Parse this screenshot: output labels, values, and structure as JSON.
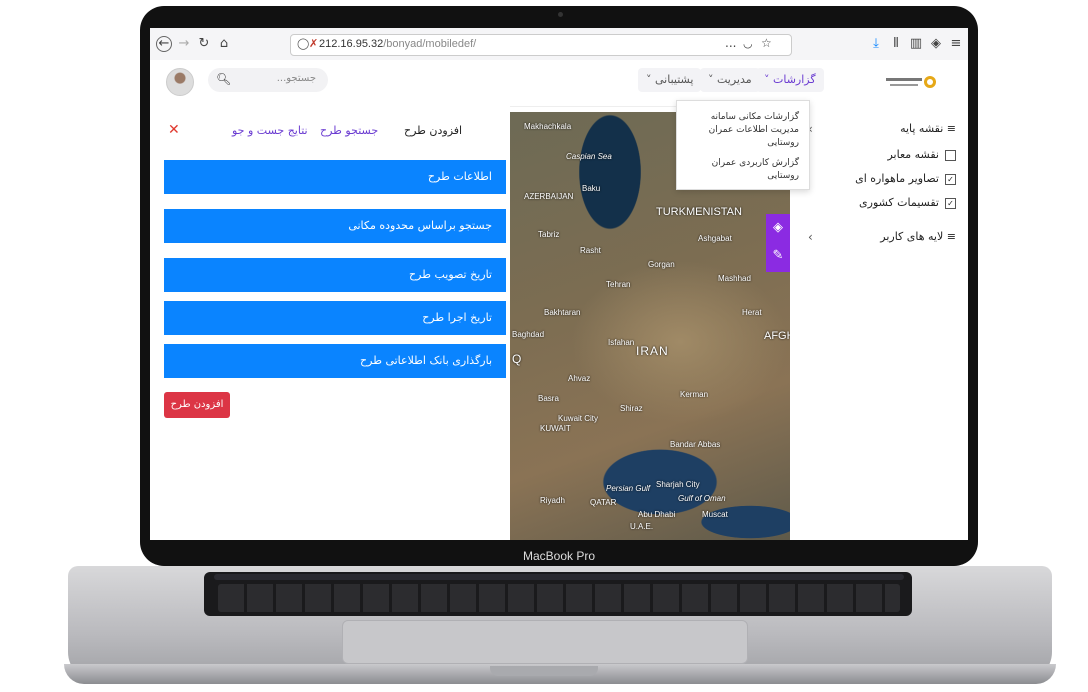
{
  "device": {
    "label": "MacBook Pro"
  },
  "browser": {
    "url_host": "212.16.95.32",
    "url_path": "/bonyad/mobiledef/",
    "more": "...",
    "colors": {
      "download": "#0a84ff"
    }
  },
  "header": {
    "search_placeholder": "جستجو...",
    "menu": [
      {
        "label": "گزارشات ˅",
        "active": true
      },
      {
        "label": "مدیریت ˅",
        "active": false
      },
      {
        "label": "پشتیبانی ˅",
        "active": false
      }
    ],
    "dropdown": [
      "گزارشات مکانی سامانه مدیریت اطلاعات عمران روستایی",
      "گزارش کاربردی عمران روستایی"
    ]
  },
  "panel": {
    "tabs": [
      "افزودن طرح",
      "جستجو طرح",
      "نتایج جست و جو"
    ],
    "buttons": [
      "اطلاعات طرح",
      "جستجو براساس محدوده مکانی",
      "تاریخ تصویب طرح",
      "تاریخ اجرا طرح",
      "بارگذاری بانک اطلاعاتی طرح"
    ],
    "add_button": "افزودن طرح",
    "close": "✕"
  },
  "map": {
    "labels": [
      "Makhachkala",
      "Caspian Sea",
      "Baku",
      "AZERBAIJAN",
      "TURKMENISTAN",
      "Ashgabat",
      "Tabriz",
      "Rasht",
      "Gorgan",
      "Mashhad",
      "Tehran",
      "Bakhtaran",
      "Herat",
      "IRAN",
      "AFGHA",
      "Baghdad",
      "Isfahan",
      "Ahvaz",
      "Basra",
      "Kerman",
      "Kuwait City",
      "KUWAIT",
      "Shiraz",
      "Bandar Abbas",
      "Persian Gulf",
      "Sharjah City",
      "Gulf of Oman",
      "Riyadh",
      "QATAR",
      "Abu Dhabi",
      "Muscat",
      "U.A.E.",
      "Q"
    ]
  },
  "layers": {
    "base_title": "نقشه پایه",
    "items": [
      {
        "label": "نقشه معابر",
        "checked": false
      },
      {
        "label": "تصاویر ماهواره ای",
        "checked": true
      },
      {
        "label": "تقسیمات کشوری",
        "checked": true
      }
    ],
    "user_title": "لایه های کاربر"
  }
}
